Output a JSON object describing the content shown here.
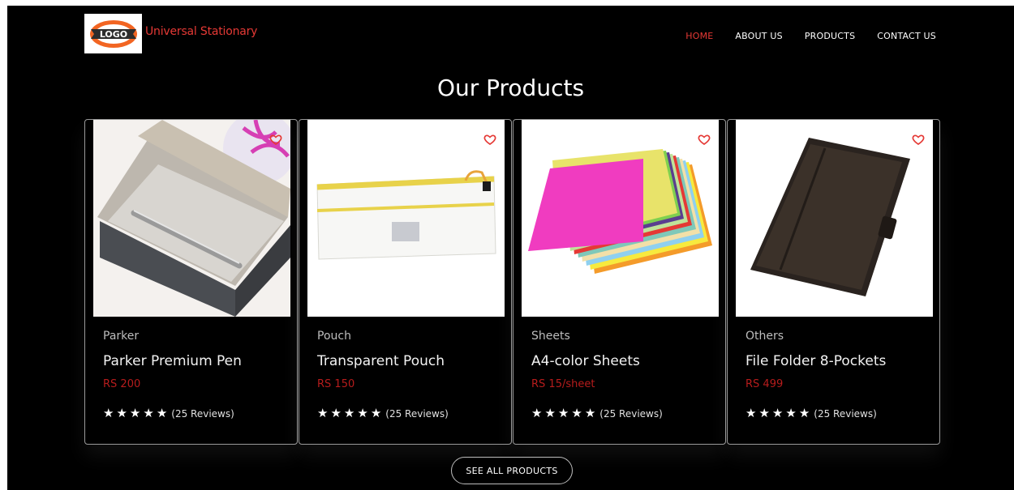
{
  "header": {
    "logo_text": "LOGO",
    "brand": "Universal Stationary",
    "nav": [
      "HOME",
      "ABOUT US",
      "PRODUCTS",
      "CONTACT US"
    ],
    "active_nav": "HOME"
  },
  "section": {
    "title": "Our Products"
  },
  "products": [
    {
      "category": "Parker",
      "name": "Parker Premium Pen",
      "price": "RS 200",
      "rating": 5,
      "reviews": "(25 Reviews)",
      "image_icon": "pen-box-image"
    },
    {
      "category": "Pouch",
      "name": "Transparent Pouch",
      "price": "RS 150",
      "rating": 5,
      "reviews": "(25 Reviews)",
      "image_icon": "pouch-image"
    },
    {
      "category": "Sheets",
      "name": "A4-color Sheets",
      "price": "RS 15/sheet",
      "rating": 5,
      "reviews": "(25 Reviews)",
      "image_icon": "color-sheets-image"
    },
    {
      "category": "Others",
      "name": "File Folder 8-Pockets",
      "price": "RS 499",
      "rating": 5,
      "reviews": "(25 Reviews)",
      "image_icon": "folder-image"
    }
  ],
  "cta": {
    "label": "SEE ALL PRODUCTS"
  },
  "colors": {
    "accent": "#e53935",
    "price": "#b71c1c",
    "background": "#000000"
  }
}
